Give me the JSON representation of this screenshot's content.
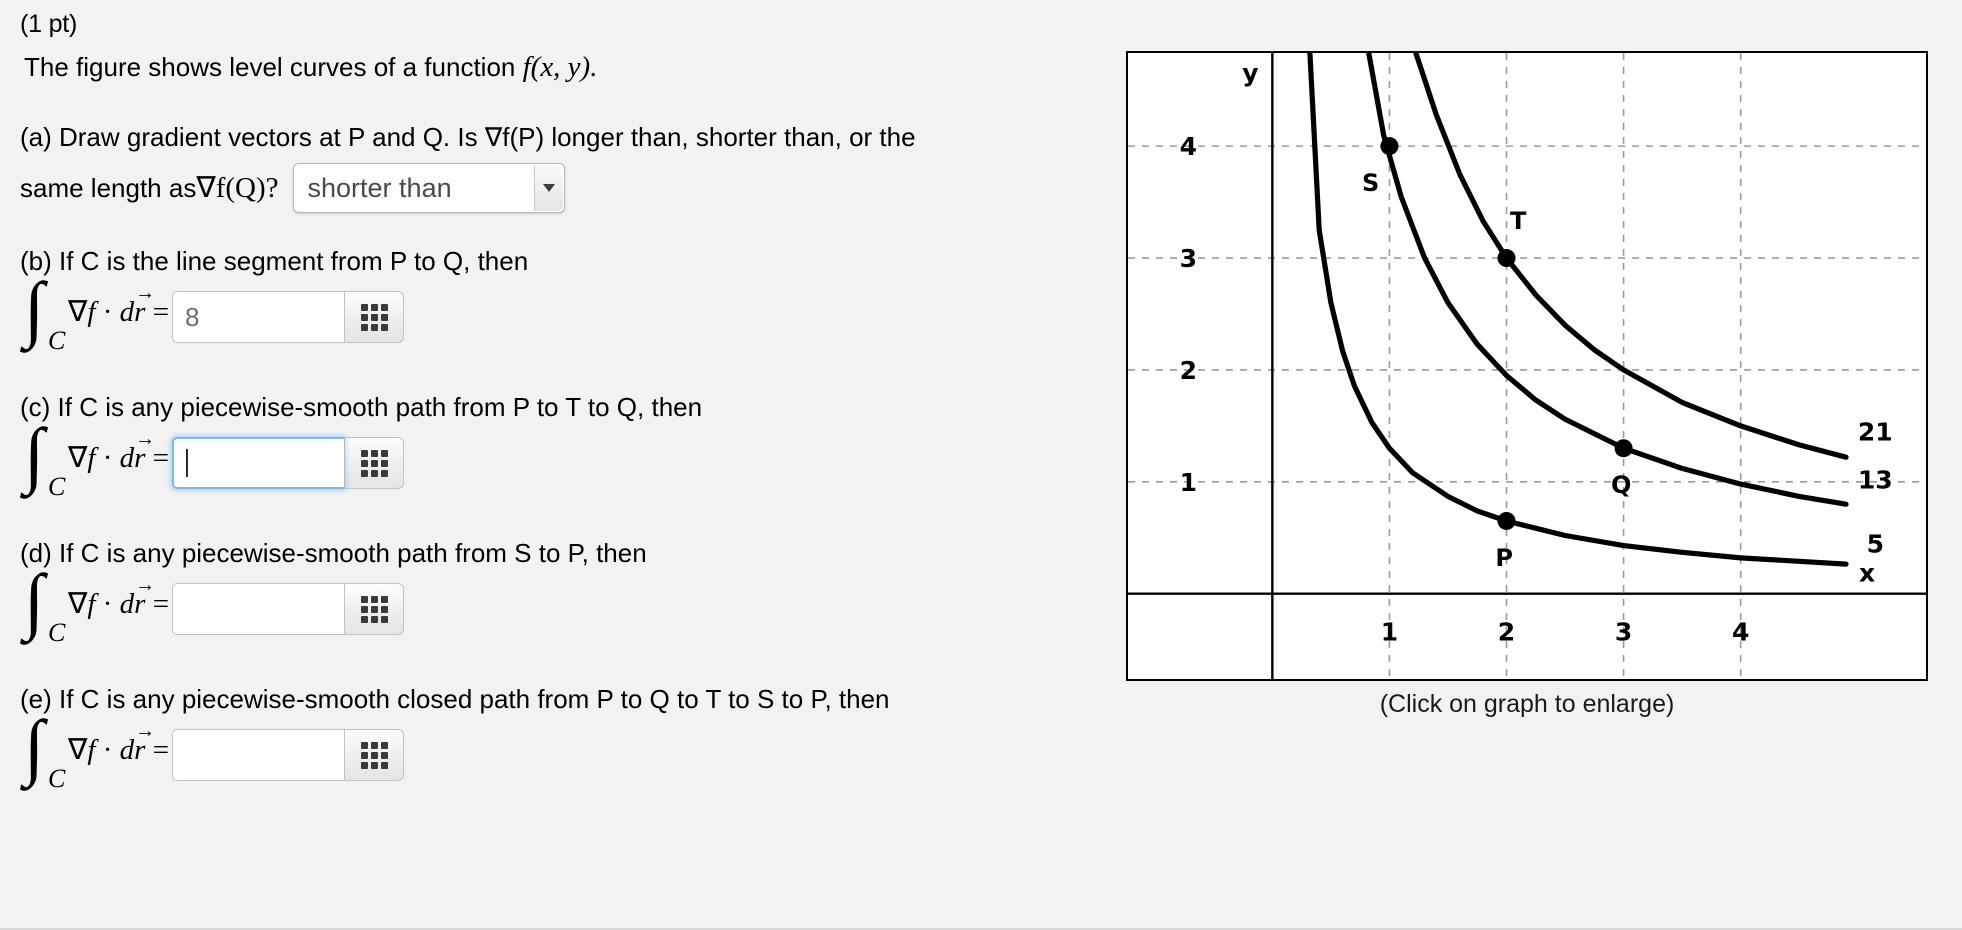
{
  "problem": {
    "points_label": "(1 pt)",
    "statement_prefix": "The figure shows level curves of a function ",
    "statement_fn": "f",
    "statement_args": "(x, y).",
    "parts": {
      "a": {
        "line1": "(a) Draw gradient vectors at P and Q. Is ∇f(P) longer than, shorter than, or the",
        "line2_pre": "same length as ",
        "line2_math": "∇f(Q)?",
        "select_value": "shorter than",
        "select_options": [
          "longer than",
          "shorter than",
          "the same length as"
        ]
      },
      "b": {
        "prompt": "(b) If C is the line segment from P to Q, then",
        "integral_sub": "C",
        "integrand": "∇f · dr",
        "equals": "=",
        "value": "8",
        "placeholder": ""
      },
      "c": {
        "prompt": "(c) If C is any piecewise-smooth path from P to T to Q, then",
        "integral_sub": "C",
        "integrand": "∇f · dr",
        "equals": "=",
        "value": "",
        "placeholder": ""
      },
      "d": {
        "prompt": "(d) If C is any piecewise-smooth path from S to P, then",
        "integral_sub": "C",
        "integrand": "∇f · dr",
        "equals": "=",
        "value": "",
        "placeholder": ""
      },
      "e": {
        "prompt": "(e) If C is any piecewise-smooth closed path from P to Q to T to S to P, then",
        "integral_sub": "C",
        "integrand": "∇f · dr",
        "equals": "=",
        "value": "",
        "placeholder": ""
      }
    },
    "keypad_icon": "keypad-grid-icon"
  },
  "graph": {
    "caption": "(Click on graph to enlarge)",
    "axis_label_x": "x",
    "axis_label_y": "y"
  },
  "chart_data": {
    "type": "line",
    "title": "",
    "xlabel": "x",
    "ylabel": "y",
    "xlim": [
      -1.25,
      5.6
    ],
    "ylim": [
      -0.78,
      4.85
    ],
    "xticks": [
      1,
      2,
      3,
      4
    ],
    "yticks": [
      1,
      2,
      3,
      4
    ],
    "xtick_labels": [
      "1",
      "2",
      "3",
      "4"
    ],
    "ytick_labels": [
      "1",
      "2",
      "3",
      "4"
    ],
    "grid": "dashed-gray",
    "legend": "none",
    "description": "Level curves (hyperbolas xy = k) of f(x,y) with labeled contour values and four marked points.",
    "series": [
      {
        "name": "5",
        "label": "5",
        "label_x": 5.15,
        "label_y": 0.45,
        "k": 1.3,
        "points": [
          [
            0.32,
            4.85
          ],
          [
            0.4,
            3.25
          ],
          [
            0.5,
            2.6
          ],
          [
            0.6,
            2.17
          ],
          [
            0.7,
            1.86
          ],
          [
            0.85,
            1.53
          ],
          [
            1.0,
            1.3
          ],
          [
            1.2,
            1.08
          ],
          [
            1.5,
            0.87
          ],
          [
            1.75,
            0.74
          ],
          [
            2.0,
            0.65
          ],
          [
            2.5,
            0.52
          ],
          [
            3.0,
            0.43
          ],
          [
            3.5,
            0.37
          ],
          [
            4.0,
            0.32
          ],
          [
            4.5,
            0.29
          ],
          [
            4.9,
            0.265
          ]
        ]
      },
      {
        "name": "13",
        "label": "13",
        "label_x": 5.15,
        "label_y": 1.02,
        "k": 3.9,
        "points": [
          [
            0.82,
            4.85
          ],
          [
            0.95,
            4.1
          ],
          [
            1.1,
            3.55
          ],
          [
            1.3,
            3.0
          ],
          [
            1.5,
            2.6
          ],
          [
            1.75,
            2.23
          ],
          [
            2.0,
            1.95
          ],
          [
            2.25,
            1.73
          ],
          [
            2.5,
            1.56
          ],
          [
            3.0,
            1.3
          ],
          [
            3.5,
            1.12
          ],
          [
            4.0,
            0.98
          ],
          [
            4.5,
            0.87
          ],
          [
            4.9,
            0.8
          ]
        ]
      },
      {
        "name": "21",
        "label": "21",
        "label_x": 5.15,
        "label_y": 1.45,
        "k": 6.0,
        "points": [
          [
            1.22,
            4.85
          ],
          [
            1.4,
            4.28
          ],
          [
            1.6,
            3.75
          ],
          [
            1.8,
            3.33
          ],
          [
            2.0,
            3.0
          ],
          [
            2.25,
            2.67
          ],
          [
            2.5,
            2.4
          ],
          [
            2.75,
            2.18
          ],
          [
            3.0,
            2.0
          ],
          [
            3.5,
            1.71
          ],
          [
            4.0,
            1.5
          ],
          [
            4.5,
            1.33
          ],
          [
            4.9,
            1.22
          ]
        ]
      }
    ],
    "points": [
      {
        "name": "S",
        "label": "S",
        "x": 1.0,
        "y": 4.0,
        "label_dx": -0.16,
        "label_dy": -0.33
      },
      {
        "name": "T",
        "label": "T",
        "x": 2.0,
        "y": 3.0,
        "label_dx": 0.1,
        "label_dy": 0.33
      },
      {
        "name": "Q",
        "label": "Q",
        "x": 3.0,
        "y": 1.3,
        "label_dx": -0.02,
        "label_dy": -0.33
      },
      {
        "name": "P",
        "label": "P",
        "x": 2.0,
        "y": 0.65,
        "label_dx": -0.02,
        "label_dy": -0.33
      }
    ]
  }
}
